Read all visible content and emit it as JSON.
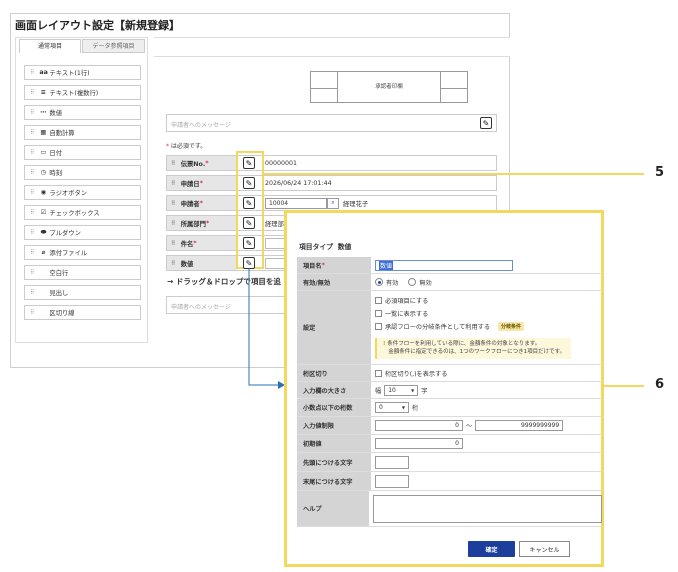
{
  "title": "画面レイアウト設定【新規登録】",
  "tabs": [
    "通常項目",
    "データ参照項目"
  ],
  "palette": [
    {
      "icon": "aa",
      "label": "テキスト(1行)"
    },
    {
      "icon": "≡",
      "label": "テキスト(複数行)"
    },
    {
      "icon": "⋯",
      "label": "数値"
    },
    {
      "icon": "▦",
      "label": "自動計算"
    },
    {
      "icon": "▭",
      "label": "日付"
    },
    {
      "icon": "◷",
      "label": "時刻"
    },
    {
      "icon": "◉",
      "label": "ラジオボタン"
    },
    {
      "icon": "☑",
      "label": "チェックボックス"
    },
    {
      "icon": "⬬",
      "label": "プルダウン"
    },
    {
      "icon": "⌀",
      "label": "添付ファイル"
    },
    {
      "icon": "",
      "label": "空白行"
    },
    {
      "icon": "",
      "label": "見出し"
    },
    {
      "icon": "",
      "label": "区切り線"
    }
  ],
  "approval_label": "承認者印欄",
  "message_placeholder": "申請者へのメッセージ",
  "required_note": {
    "star": "*",
    "text": " は必須です。"
  },
  "form_rows": [
    {
      "label": "伝票No.",
      "required": true,
      "value": "00000001"
    },
    {
      "label": "申請日",
      "required": true,
      "value": "2026/06/24 17:01:44"
    },
    {
      "label": "申請者",
      "required": true,
      "input": "10004",
      "value": "経理花子"
    },
    {
      "label": "所属部門",
      "required": true,
      "value": "経理部"
    },
    {
      "label": "件名",
      "required": true,
      "value": ""
    },
    {
      "label": "数値",
      "required": false,
      "value": ""
    }
  ],
  "drag_hint": "→ ドラッグ＆ドロップで項目を追",
  "callouts": {
    "five": "5",
    "six": "6"
  },
  "popup": {
    "type_label": "項目タイプ",
    "type_value": "数値",
    "name_label": "項目名",
    "name_value": "数値",
    "enabled_label": "有効/無効",
    "enabled_options": [
      "有効",
      "無効"
    ],
    "settings_label": "設定",
    "settings_checks": [
      "必須項目にする",
      "一覧に表示する",
      "承認フローの分岐条件として利用する"
    ],
    "branch_badge": "分岐条件",
    "note_line1": "条件フローを利用している際に、金額条件の対象となります。",
    "note_line2": "金額条件に指定できるのは、1つのワークフローにつき1項目だけです。",
    "separator_label": "桁区切り",
    "separator_check": "桁区切り(,)を表示する",
    "width_label": "入力欄の大きさ",
    "width_prefix": "幅",
    "width_value": "10",
    "width_suffix": "字",
    "decimal_label": "小数点以下の桁数",
    "decimal_value": "0",
    "decimal_suffix": "桁",
    "limit_label": "入力値制限",
    "limit_min": "0",
    "limit_tilde": "〜",
    "limit_max": "9999999999",
    "initial_label": "初期値",
    "initial_value": "0",
    "prefix_label": "先頭につける文字",
    "suffix_label": "末尾につける文字",
    "help_label": "ヘルプ",
    "ok_label": "確定",
    "cancel_label": "キャンセル"
  }
}
